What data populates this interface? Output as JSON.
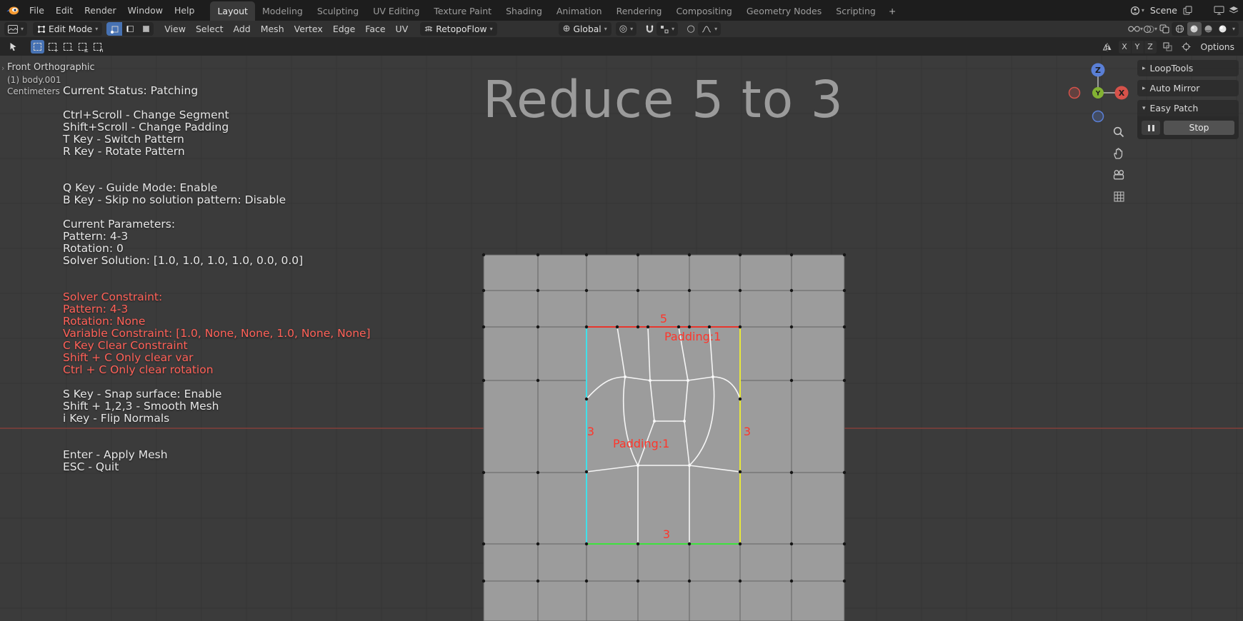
{
  "topbar": {
    "menus": [
      "File",
      "Edit",
      "Render",
      "Window",
      "Help"
    ],
    "tabs": [
      "Layout",
      "Modeling",
      "Sculpting",
      "UV Editing",
      "Texture Paint",
      "Shading",
      "Animation",
      "Rendering",
      "Compositing",
      "Geometry Nodes",
      "Scripting"
    ],
    "active_tab": "Layout",
    "add_tab_label": "+",
    "scene_label": "Scene"
  },
  "header": {
    "mode_selector": "Edit Mode",
    "menus": [
      "View",
      "Select",
      "Add",
      "Mesh",
      "Vertex",
      "Edge",
      "Face",
      "UV"
    ],
    "retopoflow_label": "RetopoFlow",
    "orientation_label": "Global"
  },
  "tool_settings": {
    "axis_toggles": [
      "X",
      "Y",
      "Z"
    ],
    "options_label": "Options"
  },
  "viewport": {
    "view_label": "Front Orthographic",
    "object_label": "(1) body.001",
    "units_label": "Centimeters",
    "big_title": "Reduce 5 to 3",
    "status_lines": [
      {
        "text": "Current Status: Patching",
        "red": false
      },
      {
        "text": "",
        "red": false
      },
      {
        "text": "Ctrl+Scroll - Change Segment",
        "red": false
      },
      {
        "text": "Shift+Scroll - Change Padding",
        "red": false
      },
      {
        "text": "T Key - Switch Pattern",
        "red": false
      },
      {
        "text": "R Key - Rotate Pattern",
        "red": false
      },
      {
        "text": "",
        "red": false
      },
      {
        "text": "",
        "red": false
      },
      {
        "text": "Q Key - Guide Mode: Enable",
        "red": false
      },
      {
        "text": "B Key - Skip no solution pattern: Disable",
        "red": false
      },
      {
        "text": "",
        "red": false
      },
      {
        "text": "Current Parameters:",
        "red": false
      },
      {
        "text": "Pattern: 4-3",
        "red": false
      },
      {
        "text": "Rotation: 0",
        "red": false
      },
      {
        "text": "Solver Solution: [1.0, 1.0, 1.0, 1.0, 0.0, 0.0]",
        "red": false
      },
      {
        "text": "",
        "red": false
      },
      {
        "text": "",
        "red": false
      },
      {
        "text": "Solver Constraint:",
        "red": true
      },
      {
        "text": "Pattern: 4-3",
        "red": true
      },
      {
        "text": "Rotation: None",
        "red": true
      },
      {
        "text": "Variable Constraint: [1.0, None, None, 1.0, None, None]",
        "red": true
      },
      {
        "text": "C Key Clear Constraint",
        "red": true
      },
      {
        "text": "Shift + C Only clear var",
        "red": true
      },
      {
        "text": "Ctrl + C Only clear rotation",
        "red": true
      },
      {
        "text": "",
        "red": false
      },
      {
        "text": "S Key - Snap surface: Enable",
        "red": false
      },
      {
        "text": "Shift + 1,2,3 - Smooth Mesh",
        "red": false
      },
      {
        "text": "i Key - Flip Normals",
        "red": false
      },
      {
        "text": "",
        "red": false
      },
      {
        "text": "",
        "red": false
      },
      {
        "text": "Enter - Apply Mesh",
        "red": false
      },
      {
        "text": "ESC - Quit",
        "red": false
      }
    ],
    "mesh_labels": {
      "top_count": "5",
      "top_padding": "Padding:1",
      "left_count": "3",
      "left_padding": "Padding:1",
      "right_count": "3",
      "bottom_count": "3"
    },
    "gizmo_axes": {
      "x": "X",
      "y": "Y",
      "z": "Z"
    }
  },
  "sidebar_panels": {
    "panels": [
      {
        "label": "LoopTools",
        "expanded": false
      },
      {
        "label": "Auto Mirror",
        "expanded": false
      },
      {
        "label": "Easy Patch",
        "expanded": true
      }
    ],
    "stop_button": "Stop"
  },
  "colors": {
    "accent_blue": "#4772b3",
    "axis_x_red": "#d6524a",
    "axis_y_green": "#83b233",
    "axis_z_blue": "#5a7fd6",
    "patch_top": "#e8352c",
    "patch_left": "#3fe0ea",
    "patch_right": "#e8e83a",
    "patch_bottom": "#3de23d",
    "viewport_label_red": "#ff362b",
    "status_red": "#ff6158"
  }
}
